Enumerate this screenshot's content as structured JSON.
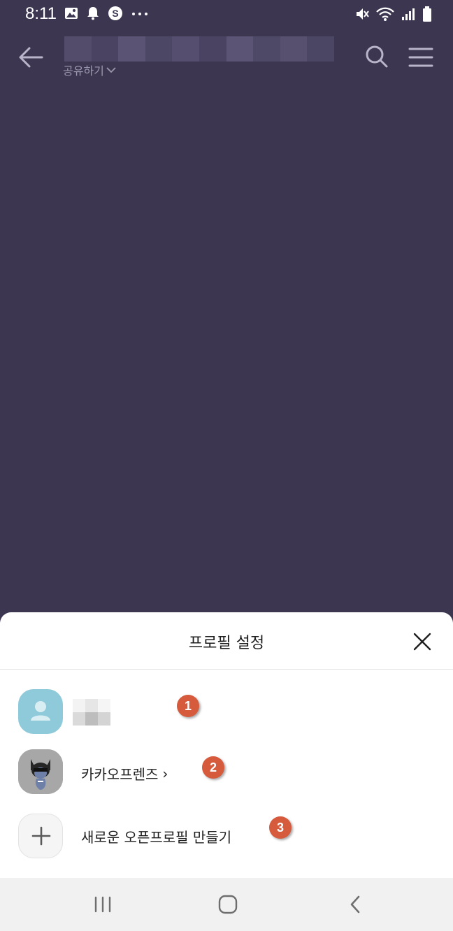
{
  "status_bar": {
    "time": "8:11",
    "left_icons": [
      "gallery-icon",
      "bell-icon",
      "s-app-icon",
      "more-dots-icon"
    ],
    "right_icons": [
      "mute-icon",
      "wifi-icon",
      "signal-icon",
      "battery-icon"
    ]
  },
  "header": {
    "share_label": "공유하기",
    "icons": [
      "back-arrow-icon",
      "search-icon",
      "menu-icon"
    ]
  },
  "sheet": {
    "title": "프로필 설정",
    "items": [
      {
        "type": "default-profile",
        "marker": "1"
      },
      {
        "label": "카카오프렌즈",
        "chevron": "›",
        "marker": "2"
      },
      {
        "label": "새로운 오픈프로필 만들기",
        "marker": "3"
      }
    ]
  },
  "colors": {
    "chat_background": "#3c3651",
    "marker": "#d65a3c",
    "avatar_default": "#8ecad9"
  },
  "nav_bar": {
    "icons": [
      "recent-apps-icon",
      "home-icon",
      "back-icon"
    ]
  }
}
